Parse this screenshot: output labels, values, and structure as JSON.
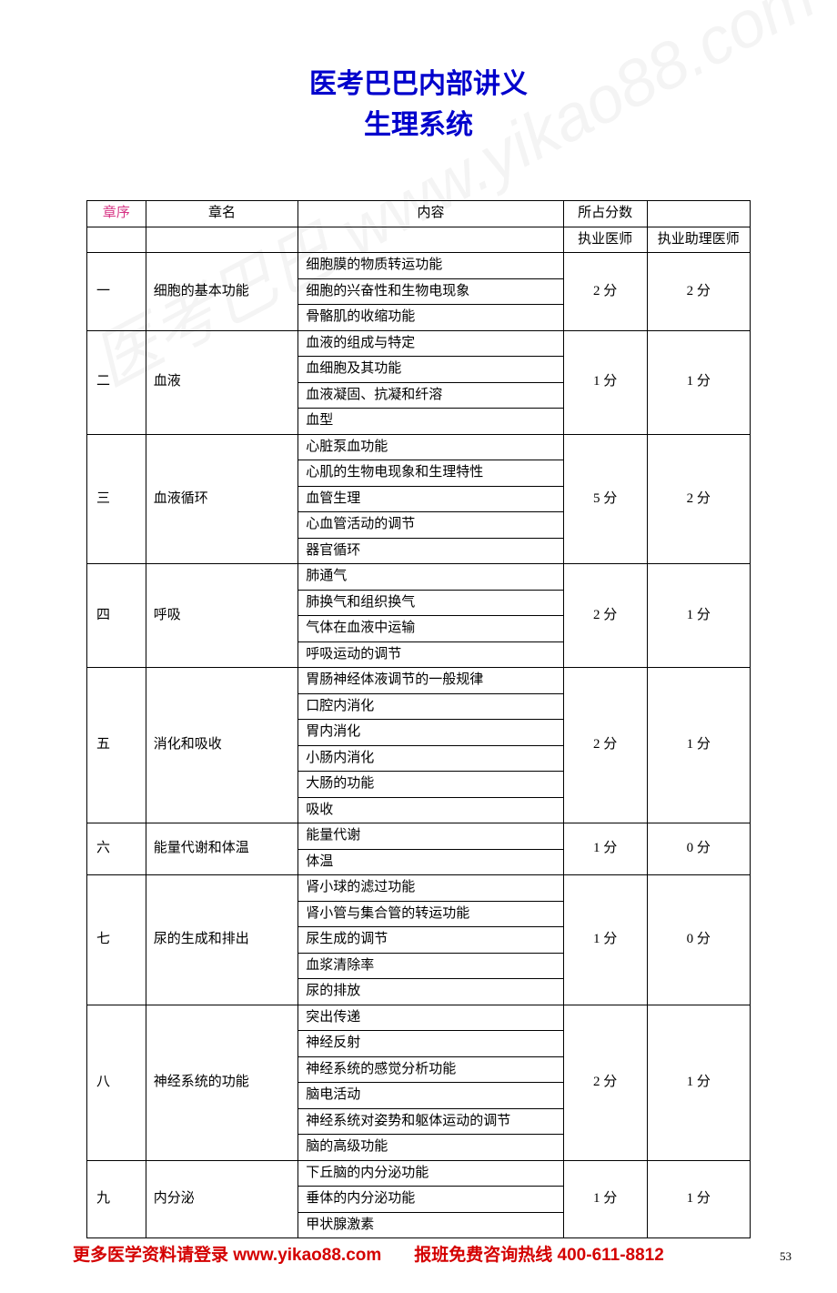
{
  "title": {
    "line1": "医考巴巴内部讲义",
    "line2": "生理系统"
  },
  "watermark": "医考巴巴 www.yikao88.com",
  "headers": {
    "seq": "章序",
    "name": "章名",
    "content": "内容",
    "score": "所占分数",
    "sub1": "执业医师",
    "sub2": "执业助理医师"
  },
  "chapters": [
    {
      "seq": "一",
      "name": "细胞的基本功能",
      "score1": "2 分",
      "score2": "2 分",
      "items": [
        "细胞膜的物质转运功能",
        "细胞的兴奋性和生物电现象",
        "骨骼肌的收缩功能"
      ]
    },
    {
      "seq": "二",
      "name": "血液",
      "score1": "1 分",
      "score2": "1 分",
      "items": [
        "血液的组成与特定",
        "血细胞及其功能",
        "血液凝固、抗凝和纤溶",
        "血型"
      ]
    },
    {
      "seq": "三",
      "name": "血液循环",
      "score1": "5 分",
      "score2": "2 分",
      "items": [
        "心脏泵血功能",
        "心肌的生物电现象和生理特性",
        "血管生理",
        "心血管活动的调节",
        "器官循环"
      ]
    },
    {
      "seq": "四",
      "name": "呼吸",
      "score1": "2 分",
      "score2": "1 分",
      "items": [
        "肺通气",
        "肺换气和组织换气",
        "气体在血液中运输",
        "呼吸运动的调节"
      ]
    },
    {
      "seq": "五",
      "name": "消化和吸收",
      "score1": "2 分",
      "score2": "1 分",
      "items": [
        "胃肠神经体液调节的一般规律",
        "口腔内消化",
        "胃内消化",
        "小肠内消化",
        "大肠的功能",
        "吸收"
      ]
    },
    {
      "seq": "六",
      "name": "能量代谢和体温",
      "score1": "1 分",
      "score2": "0 分",
      "items": [
        "能量代谢",
        "体温"
      ]
    },
    {
      "seq": "七",
      "name": "尿的生成和排出",
      "score1": "1 分",
      "score2": "0 分",
      "items": [
        "肾小球的滤过功能",
        "肾小管与集合管的转运功能",
        "尿生成的调节",
        "血浆清除率",
        "尿的排放"
      ]
    },
    {
      "seq": "八",
      "name": "神经系统的功能",
      "score1": "2 分",
      "score2": "1 分",
      "items": [
        "突出传递",
        "神经反射",
        "神经系统的感觉分析功能",
        "脑电活动",
        "神经系统对姿势和躯体运动的调节",
        "脑的高级功能"
      ]
    },
    {
      "seq": "九",
      "name": "内分泌",
      "score1": "1 分",
      "score2": "1 分",
      "items": [
        "下丘脑的内分泌功能",
        "垂体的内分泌功能",
        "甲状腺激素"
      ]
    }
  ],
  "footer": {
    "left": "更多医学资料请登录 www.yikao88.com",
    "mid": "报班免费咨询热线 400-611-8812",
    "page": "53"
  }
}
